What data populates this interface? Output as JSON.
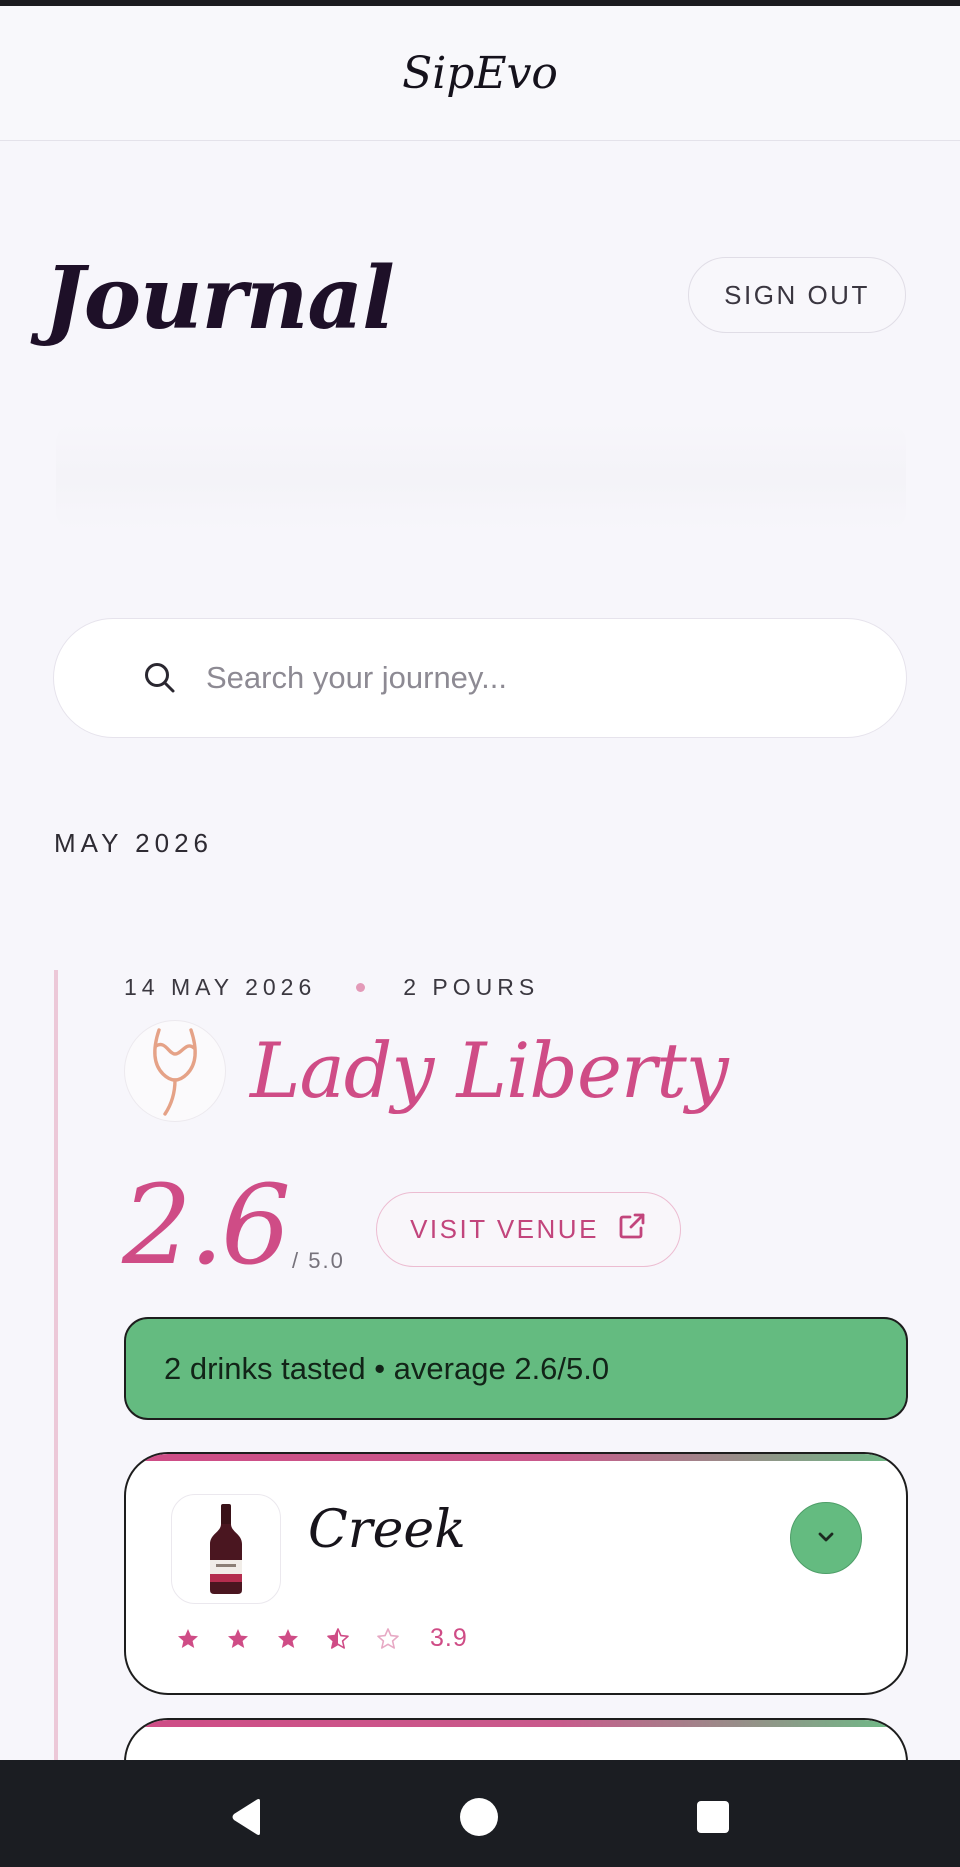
{
  "app": {
    "brand": "SipEvo"
  },
  "page": {
    "title": "Journal",
    "signout_label": "SIGN OUT"
  },
  "search": {
    "placeholder": "Search your journey..."
  },
  "journal": {
    "month_label": "MAY 2026",
    "entries": [
      {
        "date": "14 MAY 2026",
        "pours": "2 POURS",
        "venue_name": "Lady Liberty",
        "score": "2.6",
        "score_max": "/ 5.0",
        "visit_label": "VISIT VENUE",
        "summary": "2 drinks tasted • average 2.6/5.0",
        "drinks": [
          {
            "name": "Creek",
            "rating": 3.9,
            "rating_text": "3.9",
            "stars": [
              "full",
              "full",
              "full",
              "half",
              "empty"
            ]
          }
        ]
      }
    ]
  },
  "colors": {
    "accent": "#cf4c86",
    "success": "#64bb80",
    "background": "#f7f6fb"
  },
  "icons": {
    "search": "search-icon",
    "venue_logo": "wine-glass-icon",
    "visit": "external-link-icon",
    "expand": "chevron-down-icon",
    "drink_thumb": "wine-bottle-icon",
    "nav": [
      "back-icon",
      "home-icon",
      "recents-icon"
    ]
  }
}
